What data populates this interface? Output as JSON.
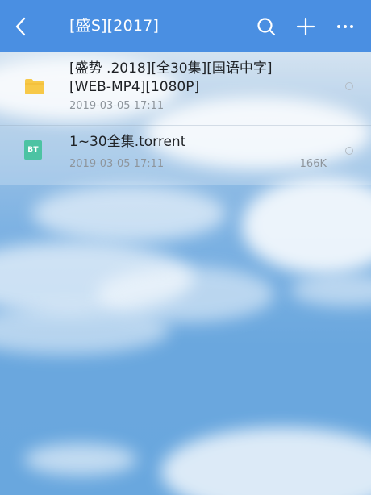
{
  "header": {
    "title": "[盛S][2017]",
    "back_icon": "chevron-left-icon",
    "search_icon": "search-icon",
    "add_icon": "plus-icon",
    "more_icon": "more-horizontal-icon"
  },
  "files": [
    {
      "name_line1": "[盛势 .2018][全30集][国语中字]",
      "name_line2": "[WEB-MP4][1080P]",
      "date": "2019-03-05 17:11",
      "size": "",
      "icon": "folder-icon",
      "type": "folder"
    },
    {
      "name_line1": "1~30全集.torrent",
      "date": "2019-03-05 17:11",
      "size": "166K",
      "icon": "bt-file-icon",
      "icon_text": "BT",
      "type": "torrent"
    }
  ],
  "colors": {
    "header_bg": "#4a8fe2",
    "folder": "#f7c948",
    "bt_badge": "#4cc3a3"
  }
}
